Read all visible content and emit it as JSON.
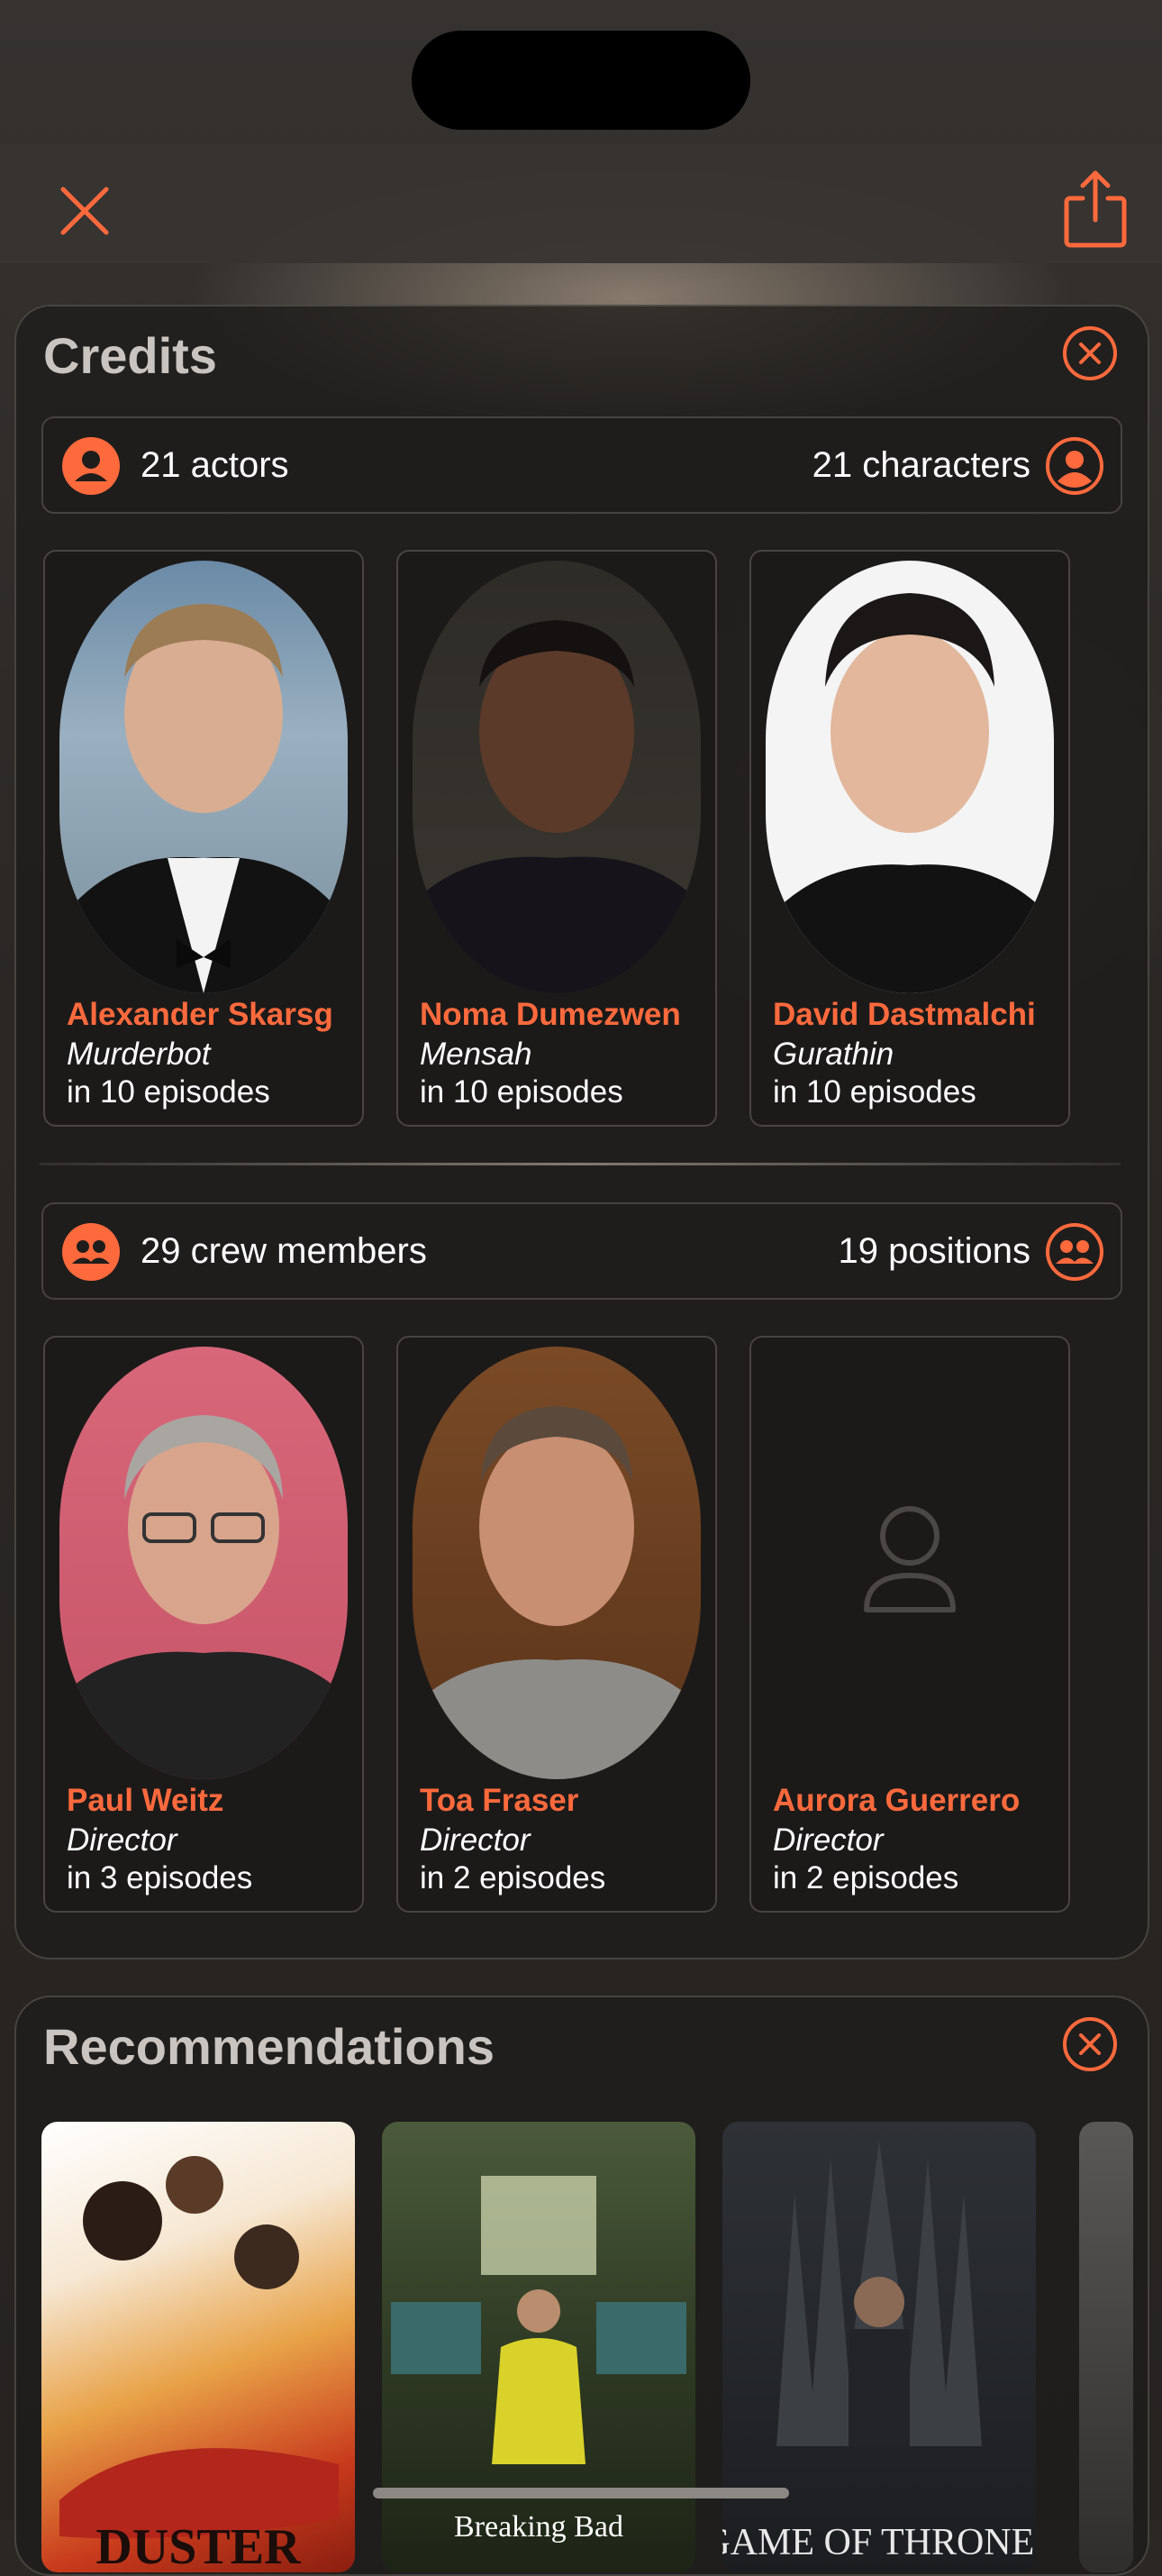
{
  "colors": {
    "accent": "#ff6a3d",
    "background": "#2a2725",
    "card": "#1c1a19"
  },
  "icons": {
    "close": "close-icon",
    "share": "share-icon",
    "panel_close": "circle-x-icon",
    "actor": "person-circle-icon",
    "crew": "group-circle-icon",
    "placeholder": "person-placeholder-icon"
  },
  "credits": {
    "title": "Credits",
    "actors_summary": {
      "left": "21 actors",
      "right": "21 characters"
    },
    "actors": [
      {
        "name": "Alexander Skarsg",
        "role": "Murderbot",
        "episodes": "in 10 episodes"
      },
      {
        "name": "Noma Dumezwen",
        "role": "Mensah",
        "episodes": "in 10 episodes"
      },
      {
        "name": "David Dastmalchi",
        "role": "Gurathin",
        "episodes": "in 10 episodes"
      }
    ],
    "crew_summary": {
      "left": "29 crew members",
      "right": "19 positions"
    },
    "crew": [
      {
        "name": "Paul Weitz",
        "role": "Director",
        "episodes": "in 3 episodes"
      },
      {
        "name": "Toa Fraser",
        "role": "Director",
        "episodes": "in 2 episodes"
      },
      {
        "name": "Aurora Guerrero",
        "role": "Director",
        "episodes": "in 2 episodes"
      }
    ]
  },
  "recommendations": {
    "title": "Recommendations",
    "posters": [
      {
        "text": "DUSTER"
      },
      {
        "text": "Breaking Bad"
      },
      {
        "text": "GAME OF THRONES"
      }
    ]
  }
}
